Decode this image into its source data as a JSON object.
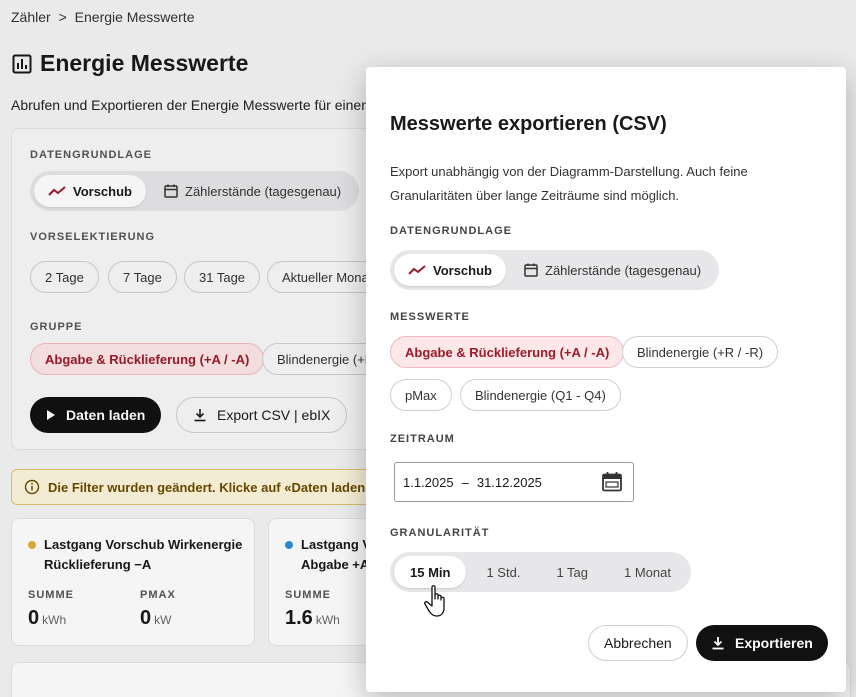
{
  "breadcrumb": {
    "parent": "Zähler",
    "separator": ">",
    "current": "Energie Messwerte"
  },
  "page": {
    "title": "Energie Messwerte",
    "subtitle": "Abrufen und Exportieren der Energie Messwerte für einen"
  },
  "filters": {
    "datengrundlage_label": "DATENGRUNDLAGE",
    "datengrundlage_options": [
      "Vorschub",
      "Zählerstände (tagesgenau)"
    ],
    "vorselektierung_label": "VORSELEKTIERUNG",
    "vorselektierung_options": [
      "2 Tage",
      "7 Tage",
      "31 Tage",
      "Aktueller Mona"
    ],
    "gruppe_label": "GRUPPE",
    "gruppe_options": [
      "Abgabe & Rücklieferung (+A / -A)",
      "Blindenergie (+R"
    ],
    "load_button": "Daten laden",
    "export_button": "Export CSV | ebIX"
  },
  "warning": {
    "text": "Die Filter wurden geändert. Klicke auf «Daten laden», u"
  },
  "cards": [
    {
      "title_line1": "Lastgang Vorschub Wirkenergie",
      "title_line2": "Rücklieferung −A",
      "dot_color": "#e0b13a",
      "stats": [
        {
          "label": "SUMME",
          "value": "0",
          "unit": "kWh"
        },
        {
          "label": "PMAX",
          "value": "0",
          "unit": "kW"
        }
      ]
    },
    {
      "title_line1": "Lastgang V",
      "title_line2": "Abgabe +A",
      "dot_color": "#2f8fd8",
      "stats": [
        {
          "label": "SUMME",
          "value": "1.6",
          "unit": "kWh"
        }
      ]
    }
  ],
  "dialog": {
    "title": "Messwerte exportieren (CSV)",
    "description": "Export unabhängig von der Diagramm-Darstellung. Auch feine Granularitäten über lange Zeiträume sind möglich.",
    "datengrundlage_label": "DATENGRUNDLAGE",
    "datengrundlage_options": [
      "Vorschub",
      "Zählerstände (tagesgenau)"
    ],
    "messwerte_label": "MESSWERTE",
    "messwerte_options": [
      "Abgabe & Rücklieferung (+A / -A)",
      "Blindenergie (+R / -R)",
      "pMax",
      "Blindenergie (Q1 - Q4)"
    ],
    "zeitraum_label": "ZEITRAUM",
    "date_from": "1.1.2025",
    "date_sep": "–",
    "date_to": "31.12.2025",
    "granularitaet_label": "GRANULARITÄT",
    "granularitaet_options": [
      "15 Min",
      "1 Std.",
      "1 Tag",
      "1 Monat"
    ],
    "cancel_button": "Abbrechen",
    "export_button": "Exportieren"
  },
  "colors": {
    "accent_red": "#9b1c2a",
    "red_bg": "#fde7e9",
    "dark": "#111111",
    "warning_bg": "#fdf6dc"
  },
  "icons": [
    "chart-icon",
    "trend-line-icon",
    "calendar-icon",
    "play-icon",
    "download-icon",
    "info-icon",
    "hand-cursor-icon"
  ]
}
